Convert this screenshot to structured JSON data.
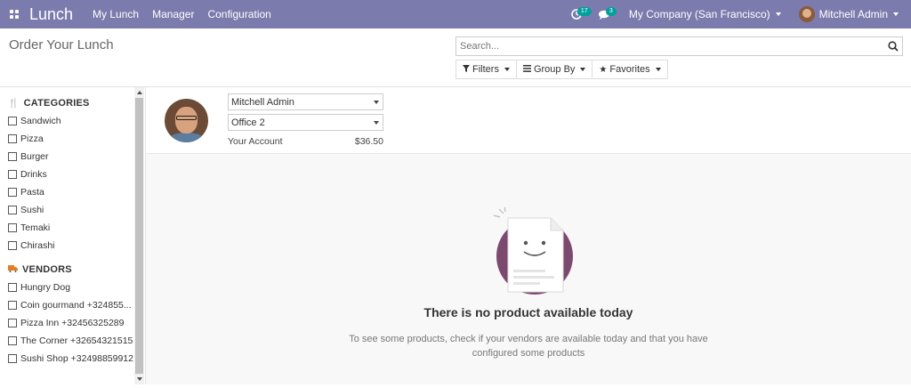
{
  "navbar": {
    "brand": "Lunch",
    "menu": [
      "My Lunch",
      "Manager",
      "Configuration"
    ],
    "activity_count": "17",
    "messages_count": "3",
    "company": "My Company (San Francisco)",
    "user": "Mitchell Admin",
    "bg_color": "#7c7bad"
  },
  "control_panel": {
    "title": "Order Your Lunch",
    "search_placeholder": "Search...",
    "filters_label": "Filters",
    "groupby_label": "Group By",
    "favorites_label": "Favorites"
  },
  "sidebar": {
    "categories_title": "CATEGORIES",
    "categories": [
      "Sandwich",
      "Pizza",
      "Burger",
      "Drinks",
      "Pasta",
      "Sushi",
      "Temaki",
      "Chirashi"
    ],
    "vendors_title": "VENDORS",
    "vendors": [
      "Hungry Dog",
      "Coin gourmand +324855...",
      "Pizza Inn +32456325289",
      "The Corner +32654321515",
      "Sushi Shop +32498859912"
    ]
  },
  "user_panel": {
    "user_select": "Mitchell Admin",
    "location_select": "Office 2",
    "account_label": "Your Account",
    "account_value": "$36.50"
  },
  "empty_state": {
    "title": "There is no product available today",
    "text": "To see some products, check if your vendors are available today and that you have configured some products"
  }
}
